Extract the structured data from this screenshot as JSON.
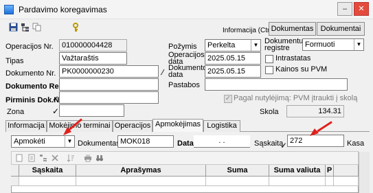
{
  "window": {
    "title": "Pardavimo koregavimas",
    "min_symbol": "–",
    "close_symbol": "✕"
  },
  "toolbar": {
    "icons": [
      "save-icon",
      "tree-icon",
      "copy-icon",
      "key-icon"
    ],
    "info_label": "Informacija (Ctrl+..",
    "dokumentas_btn": "Dokumentas",
    "dokumentai_btn": "Dokumentai"
  },
  "form": {
    "operacijos_nr": {
      "label": "Operacijos Nr.",
      "value": "010000004428"
    },
    "tipas": {
      "label": "Tipas",
      "value": "Važtaraštis"
    },
    "dokumento_nr": {
      "label": "Dokumento Nr.",
      "value": "PK0000000230"
    },
    "dokumento_reg": {
      "label": "Dokumento Reg.",
      "value": ""
    },
    "pirminis": {
      "label": "Pirminis Dok.Nr.",
      "value": ""
    },
    "zona": {
      "label": "Zona",
      "value": ""
    },
    "pozymis": {
      "label": "Požymis",
      "value": "Perkelta"
    },
    "dokumentu_registre": {
      "label1": "Dokumentu",
      "label2": "registre",
      "value": "Formuoti"
    },
    "operacijos_data": {
      "label1": "Operacijos",
      "label2": "data",
      "value": "2025.05.15"
    },
    "dokumento_data": {
      "label1": "Dokumento",
      "label2": "data",
      "value": "2025.05.15"
    },
    "intrastatas": {
      "label": "Intrastatas",
      "checked": false
    },
    "kainos_su_pvm": {
      "label": "Kainos su PVM",
      "checked": false
    },
    "pastabos": {
      "label": "Pastabos",
      "value": ""
    },
    "pagal_nutylejima": {
      "label": "Pagal nutylėjimą: PVM įtraukti į skolą",
      "checked": true
    },
    "skola": {
      "label": "Skola",
      "value": "134.31"
    }
  },
  "tabs": [
    {
      "label": "Informacija",
      "active": false
    },
    {
      "label": "Mokėjimo terminai",
      "active": false
    },
    {
      "label": "Operacijos",
      "active": false
    },
    {
      "label": "Apmokėjimas",
      "active": true
    },
    {
      "label": "Logistika",
      "active": false
    }
  ],
  "payment": {
    "type_value": "Apmokėti",
    "dokumentas_label": "Dokumentas",
    "dokumentas_value": "MOK018",
    "data_label": "Data",
    "data_value": ". .",
    "saskaita_label": "Sąskaita",
    "saskaita_value": "272",
    "kasa_label": "Kasa"
  },
  "grid": {
    "toolbar_icons": [
      "new-doc-icon",
      "doc-icon",
      "tree-icon",
      "delete-icon",
      "sort-icon",
      "print-icon",
      "binoculars-icon"
    ],
    "columns": [
      "Sąskaita",
      "Aprašymas",
      "Suma",
      "Suma valiuta",
      "P",
      ""
    ]
  },
  "colors": {
    "accent_arrow": "#e0201b",
    "field_bg": "#ffffff",
    "window_bg": "#f0f0f0"
  }
}
